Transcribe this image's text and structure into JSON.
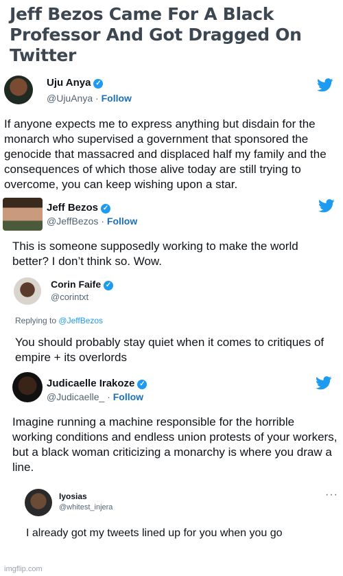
{
  "headline": "Jeff Bezos Came For A Black Professor And Got Dragged On Twitter",
  "tweets": [
    {
      "name": "Uju Anya",
      "handle": "@UjuAnya",
      "follow": "Follow",
      "text": "If anyone expects me to express anything but disdain for the monarch who supervised a government that sponsored the genocide that massacred and displaced half my family and the consequences of which those alive today are still trying to overcome, you can keep wishing upon a star."
    },
    {
      "name": "Jeff Bezos",
      "handle": "@JeffBezos",
      "follow": "Follow",
      "text": "This is someone supposedly working to make the world better? I don’t think so. Wow."
    },
    {
      "name": "Corin Faife",
      "handle": "@corintxt",
      "reply_prefix": "Replying to",
      "reply_to": "@JeffBezos",
      "text": "You should probably stay quiet when it comes to critiques of empire + its overlords"
    },
    {
      "name": "Judicaelle Irakoze",
      "handle": "@Judicaelle_",
      "follow": "Follow",
      "text": "Imagine running a machine responsible for the horrible working conditions and endless union protests of your workers, but a black woman criticizing a monarchy is where you draw a line."
    },
    {
      "name": "Iyosias",
      "handle": "@whitest_injera",
      "more": "···",
      "text": "I already got my tweets lined up for you when you go"
    }
  ],
  "watermark": "imgflip.com",
  "colors": {
    "twitter_blue": "#1d9bf0",
    "follow_blue": "#1d6fb8",
    "headline": "#3d4752"
  },
  "icons": [
    "twitter-bird-icon",
    "verified-badge-icon"
  ]
}
